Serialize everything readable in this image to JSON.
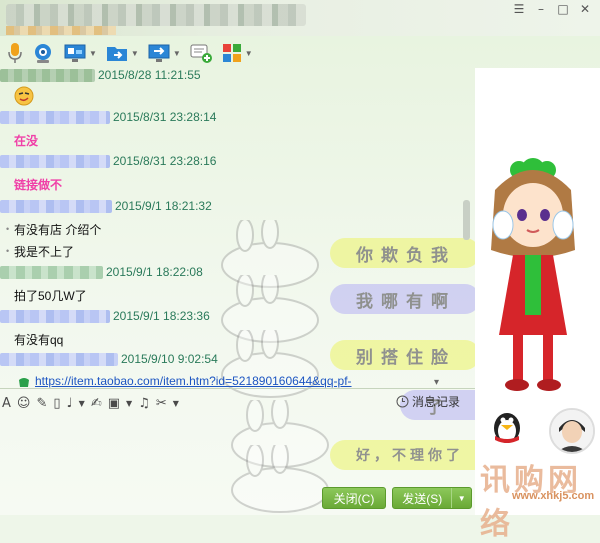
{
  "window": {
    "controls": {
      "skin": "☰",
      "minimize": "–",
      "maximize": "□",
      "close": "✕"
    }
  },
  "toolbar": {
    "items": [
      {
        "name": "voice-icon"
      },
      {
        "name": "video-icon"
      },
      {
        "name": "screen-share-icon"
      },
      {
        "name": "file-transfer-icon"
      },
      {
        "name": "remote-desktop-icon"
      },
      {
        "name": "send-message-icon"
      },
      {
        "name": "apps-icon"
      }
    ]
  },
  "chat": {
    "messages": [
      {
        "time": "2015/8/28 11:21:55",
        "text": ""
      },
      {
        "time": "2015/8/31 23:28:14",
        "text": "在没"
      },
      {
        "time": "2015/8/31 23:28:16",
        "text": "链接做不"
      },
      {
        "time": "2015/9/1 18:21:32",
        "lines": [
          "有没有店 介绍个",
          "我是不上了"
        ]
      },
      {
        "time": "2015/9/1 18:22:08",
        "text": "拍了50几W了"
      },
      {
        "time": "2015/9/1 18:23:36",
        "text": "有没有qq"
      },
      {
        "time": "2015/9/10 9:02:54",
        "link": "https://item.taobao.com/item.htm?id=521890160644&qq-pf-"
      }
    ]
  },
  "input_toolbar": {
    "history_label": "消息记录"
  },
  "buttons": {
    "close_label": "关闭(C)",
    "send_label": "发送(S)"
  },
  "watermark": {
    "text": "讯购网络",
    "url": "www.xhkj5.com"
  },
  "decor": {
    "bubbles": [
      "你欺负我",
      "我哪有啊",
      "别搭住脸",
      "了",
      "好，不理你了"
    ]
  },
  "colors": {
    "accent_green": "#6aa936",
    "timestamp": "#2a7a5a",
    "pink_text": "#f040a8",
    "link": "#1d55c2"
  }
}
